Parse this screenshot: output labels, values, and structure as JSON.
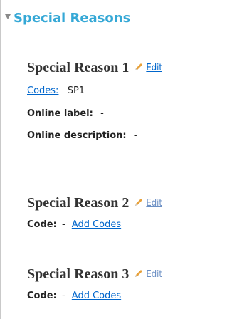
{
  "section": {
    "title": "Special Reasons"
  },
  "reasons": [
    {
      "title": "Special Reason 1",
      "edit_label": "Edit",
      "codes_label": "Codes:",
      "codes_value": "SP1",
      "online_label_label": "Online label:",
      "online_label_value": "-",
      "online_description_label": "Online description:",
      "online_description_value": "-"
    },
    {
      "title": "Special Reason 2",
      "edit_label": "Edit",
      "code_label": "Code:",
      "code_value": "-",
      "add_codes_label": "Add Codes"
    },
    {
      "title": "Special Reason 3",
      "edit_label": "Edit",
      "code_label": "Code:",
      "code_value": "-",
      "add_codes_label": "Add Codes"
    }
  ],
  "colors": {
    "section_title": "#35a8d6",
    "link": "#0066cc",
    "pencil": "#e8a13a"
  },
  "icons": {
    "collapse": "triangle-down-icon",
    "edit": "pencil-icon"
  }
}
